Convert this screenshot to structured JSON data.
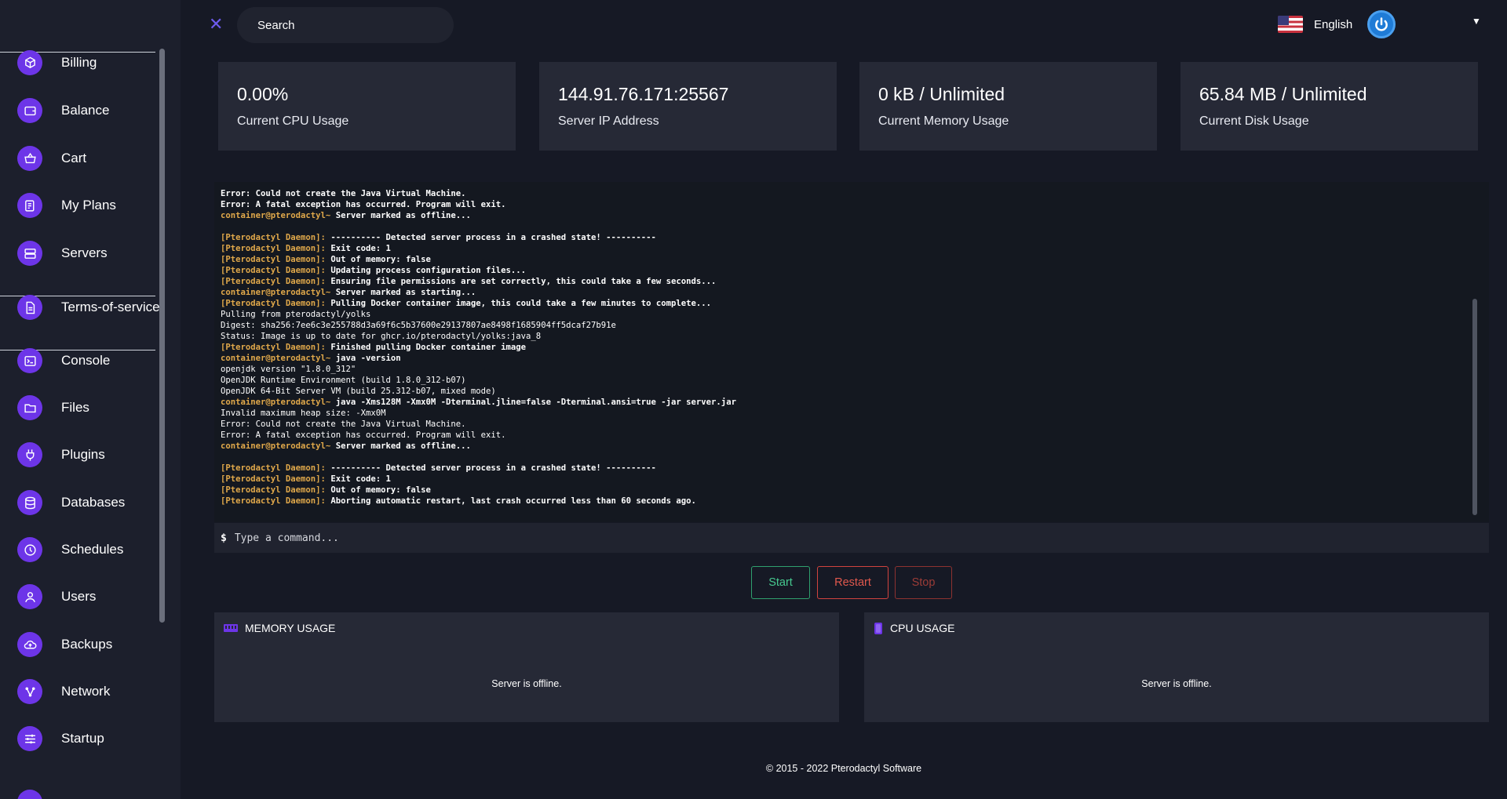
{
  "search": {
    "placeholder": "Search"
  },
  "language": {
    "label": "English"
  },
  "sidebar": {
    "items": [
      {
        "label": "Billing",
        "icon": "billing-icon"
      },
      {
        "label": "Balance",
        "icon": "wallet-icon"
      },
      {
        "label": "Cart",
        "icon": "cart-icon"
      },
      {
        "label": "My Plans",
        "icon": "plans-icon"
      },
      {
        "label": "Servers",
        "icon": "server-icon"
      },
      {
        "label": "Terms-of-service",
        "icon": "document-icon"
      },
      {
        "label": "Console",
        "icon": "terminal-icon"
      },
      {
        "label": "Files",
        "icon": "folder-icon"
      },
      {
        "label": "Plugins",
        "icon": "plug-icon"
      },
      {
        "label": "Databases",
        "icon": "database-icon"
      },
      {
        "label": "Schedules",
        "icon": "clock-icon"
      },
      {
        "label": "Users",
        "icon": "user-icon"
      },
      {
        "label": "Backups",
        "icon": "cloud-upload-icon"
      },
      {
        "label": "Network",
        "icon": "network-icon"
      },
      {
        "label": "Startup",
        "icon": "sliders-icon"
      }
    ]
  },
  "stats": [
    {
      "value": "0.00%",
      "label": "Current CPU Usage"
    },
    {
      "value": "144.91.76.171:25567",
      "label": "Server IP Address"
    },
    {
      "value": "0 kB / Unlimited",
      "label": "Current Memory Usage"
    },
    {
      "value": "65.84 MB / Unlimited",
      "label": "Current Disk Usage"
    }
  ],
  "console": {
    "lines": [
      {
        "parts": [
          {
            "t": "Error: Could not create the Java Virtual Machine.",
            "c": "bd"
          }
        ]
      },
      {
        "parts": [
          {
            "t": "Error: A fatal exception has occurred. Program will exit.",
            "c": "bd"
          }
        ]
      },
      {
        "parts": [
          {
            "t": "container@pterodactyl~",
            "c": "hl"
          },
          {
            "t": " Server marked as offline...",
            "c": "bd"
          }
        ]
      },
      {
        "parts": [
          {
            "t": "",
            "c": ""
          }
        ]
      },
      {
        "parts": [
          {
            "t": "[Pterodactyl Daemon]:",
            "c": "hl"
          },
          {
            "t": " ---------- Detected server process in a crashed state! ----------",
            "c": "bd"
          }
        ]
      },
      {
        "parts": [
          {
            "t": "[Pterodactyl Daemon]:",
            "c": "hl"
          },
          {
            "t": " Exit code: 1",
            "c": "bd"
          }
        ]
      },
      {
        "parts": [
          {
            "t": "[Pterodactyl Daemon]:",
            "c": "hl"
          },
          {
            "t": " Out of memory: false",
            "c": "bd"
          }
        ]
      },
      {
        "parts": [
          {
            "t": "[Pterodactyl Daemon]:",
            "c": "hl"
          },
          {
            "t": " Updating process configuration files...",
            "c": "bd"
          }
        ]
      },
      {
        "parts": [
          {
            "t": "[Pterodactyl Daemon]:",
            "c": "hl"
          },
          {
            "t": " Ensuring file permissions are set correctly, this could take a few seconds...",
            "c": "bd"
          }
        ]
      },
      {
        "parts": [
          {
            "t": "container@pterodactyl~",
            "c": "hl"
          },
          {
            "t": " Server marked as starting...",
            "c": "bd"
          }
        ]
      },
      {
        "parts": [
          {
            "t": "[Pterodactyl Daemon]:",
            "c": "hl"
          },
          {
            "t": " Pulling Docker container image, this could take a few minutes to complete...",
            "c": "bd"
          }
        ]
      },
      {
        "parts": [
          {
            "t": "Pulling from pterodactyl/yolks",
            "c": ""
          }
        ]
      },
      {
        "parts": [
          {
            "t": "Digest: sha256:7ee6c3e255788d3a69f6c5b37600e29137807ae8498f1685904ff5dcaf27b91e",
            "c": ""
          }
        ]
      },
      {
        "parts": [
          {
            "t": "Status: Image is up to date for ghcr.io/pterodactyl/yolks:java_8",
            "c": ""
          }
        ]
      },
      {
        "parts": [
          {
            "t": "[Pterodactyl Daemon]:",
            "c": "hl"
          },
          {
            "t": " Finished pulling Docker container image",
            "c": "bd"
          }
        ]
      },
      {
        "parts": [
          {
            "t": "container@pterodactyl~",
            "c": "hl"
          },
          {
            "t": " java -version",
            "c": "bd"
          }
        ]
      },
      {
        "parts": [
          {
            "t": "openjdk version \"1.8.0_312\"",
            "c": ""
          }
        ]
      },
      {
        "parts": [
          {
            "t": "OpenJDK Runtime Environment (build 1.8.0_312-b07)",
            "c": ""
          }
        ]
      },
      {
        "parts": [
          {
            "t": "OpenJDK 64-Bit Server VM (build 25.312-b07, mixed mode)",
            "c": ""
          }
        ]
      },
      {
        "parts": [
          {
            "t": "container@pterodactyl~",
            "c": "hl"
          },
          {
            "t": " java -Xms128M -Xmx0M -Dterminal.jline=false -Dterminal.ansi=true -jar server.jar",
            "c": "bd"
          }
        ]
      },
      {
        "parts": [
          {
            "t": "Invalid maximum heap size: -Xmx0M",
            "c": ""
          }
        ]
      },
      {
        "parts": [
          {
            "t": "Error: Could not create the Java Virtual Machine.",
            "c": ""
          }
        ]
      },
      {
        "parts": [
          {
            "t": "Error: A fatal exception has occurred. Program will exit.",
            "c": ""
          }
        ]
      },
      {
        "parts": [
          {
            "t": "container@pterodactyl~",
            "c": "hl"
          },
          {
            "t": " Server marked as offline...",
            "c": "bd"
          }
        ]
      },
      {
        "parts": [
          {
            "t": "",
            "c": ""
          }
        ]
      },
      {
        "parts": [
          {
            "t": "[Pterodactyl Daemon]:",
            "c": "hl"
          },
          {
            "t": " ---------- Detected server process in a crashed state! ----------",
            "c": "bd"
          }
        ]
      },
      {
        "parts": [
          {
            "t": "[Pterodactyl Daemon]:",
            "c": "hl"
          },
          {
            "t": " Exit code: 1",
            "c": "bd"
          }
        ]
      },
      {
        "parts": [
          {
            "t": "[Pterodactyl Daemon]:",
            "c": "hl"
          },
          {
            "t": " Out of memory: false",
            "c": "bd"
          }
        ]
      },
      {
        "parts": [
          {
            "t": "[Pterodactyl Daemon]:",
            "c": "hl"
          },
          {
            "t": " Aborting automatic restart, last crash occurred less than 60 seconds ago.",
            "c": "bd"
          }
        ]
      }
    ],
    "prompt": "$",
    "placeholder": "Type a command..."
  },
  "buttons": {
    "start": "Start",
    "restart": "Restart",
    "stop": "Stop"
  },
  "panels": {
    "memory": {
      "title": "MEMORY USAGE",
      "message": "Server is offline."
    },
    "cpu": {
      "title": "CPU USAGE",
      "message": "Server is offline."
    }
  },
  "footer": {
    "text": "© 2015 - 2022 Pterodactyl Software"
  },
  "colors": {
    "accent": "#6d35e8",
    "start": "#46c98f",
    "restart": "#e0584d",
    "stop": "#9c3c37",
    "console_highlight": "#e0a84a"
  }
}
